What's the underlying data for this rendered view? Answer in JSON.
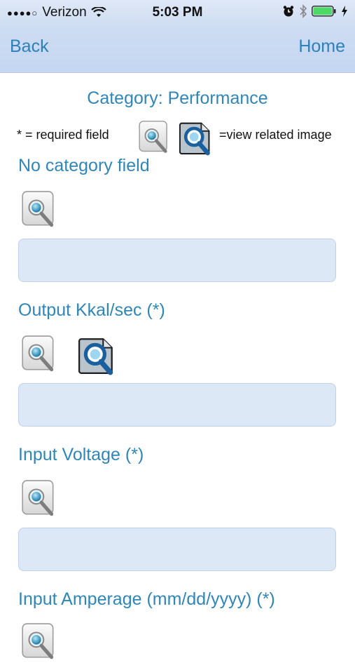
{
  "status_bar": {
    "signal_dots": "●●●●○",
    "carrier": "Verizon",
    "time": "5:03 PM"
  },
  "nav": {
    "back_label": "Back",
    "home_label": "Home"
  },
  "page": {
    "category_title": "Category: Performance",
    "legend_required": "* = required field",
    "legend_related": "=view related image"
  },
  "fields": [
    {
      "label": "No category field",
      "value": "",
      "icons": [
        "magnifier-doc-icon"
      ]
    },
    {
      "label": "Output Kkal/sec (*)",
      "value": "",
      "icons": [
        "magnifier-doc-icon",
        "related-image-icon"
      ]
    },
    {
      "label": "Input Voltage (*)",
      "value": "",
      "icons": [
        "magnifier-doc-icon"
      ]
    },
    {
      "label": "Input Amperage (mm/dd/yyyy) (*)",
      "value": "",
      "icons": [
        "magnifier-doc-icon"
      ]
    }
  ],
  "colors": {
    "accent": "#2f86b9",
    "input_bg": "#dde8f7",
    "nav_bg": "#c4d6f0"
  }
}
